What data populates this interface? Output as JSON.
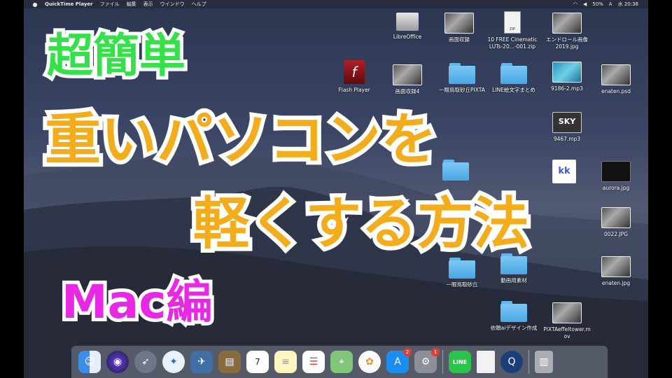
{
  "menubar": {
    "apple": "",
    "app": "QuickTime Player",
    "items": [
      "ファイル",
      "編集",
      "表示",
      "ウインドウ",
      "ヘルプ"
    ],
    "battery": "50%",
    "input": "A",
    "clock": "水 20:38"
  },
  "desktop": {
    "row1": [
      {
        "label": "LibreOffice",
        "icon": "drive-icon"
      },
      {
        "label": "画面収録",
        "icon": "screenshot-icon"
      },
      {
        "label": "10 FREE Cinematic\nLUTs-20...-001.zip",
        "icon": "zip-icon"
      },
      {
        "label": "エンドロール画像\n2019.jpg",
        "icon": "image-icon"
      }
    ],
    "row2": [
      {
        "label": "Flash Player",
        "icon": "flash-icon"
      },
      {
        "label": "画面収録4",
        "icon": "screenshot-icon"
      },
      {
        "label": "一眼鳥取砂丘PIXTA",
        "icon": "folder-icon"
      },
      {
        "label": "LINE絵文字まとめ",
        "icon": "folder-icon"
      },
      {
        "label": "9186-2.mp3",
        "icon": "audio-icon"
      },
      {
        "label": "enaten.psd",
        "icon": "image-icon"
      }
    ],
    "row3": [
      {
        "label": "9467.mp3",
        "icon": "sky-icon",
        "thumb_text": "SKY"
      },
      {
        "label": "kk",
        "icon": "kk-icon",
        "thumb_text": "kk"
      },
      {
        "label": "aurora.jpg",
        "icon": "image-icon"
      }
    ],
    "row4": [
      {
        "label": "0022.JPG",
        "icon": "image-icon"
      }
    ],
    "row5": [
      {
        "label": "一眼鳥取砂丘",
        "icon": "folder-icon"
      },
      {
        "label": "動画用素材",
        "icon": "folder-icon"
      },
      {
        "label": "enaten.jpg",
        "icon": "image-icon"
      }
    ],
    "row6": [
      {
        "label": "依頼aiデザイン作成",
        "icon": "folder-icon"
      },
      {
        "label": "PIXTAeffeltower.m\nov",
        "icon": "movie-icon"
      }
    ]
  },
  "titles": {
    "line1": "超簡単",
    "line2": "重いパソコンを",
    "line3": "軽くする方法",
    "line4": "Mac編"
  },
  "dock": {
    "calendar_day": "7",
    "appstore_badge": "2",
    "prefs_badge": "1",
    "line_label": "LINE"
  },
  "colors": {
    "green_title": "#36e04b",
    "orange_title": "#f3ad1c",
    "magenta_title": "#e829e3"
  }
}
